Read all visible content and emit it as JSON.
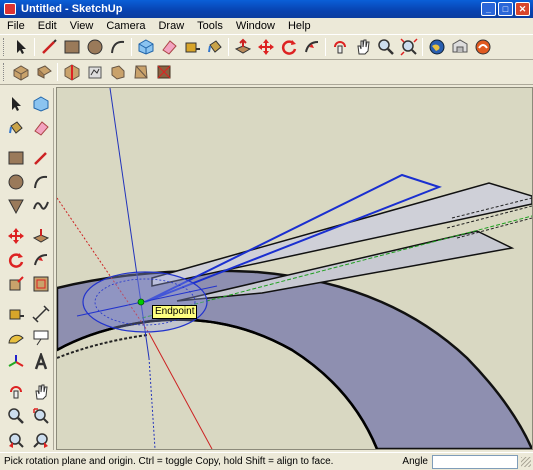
{
  "window": {
    "title": "Untitled - SketchUp"
  },
  "menu": [
    "File",
    "Edit",
    "View",
    "Camera",
    "Draw",
    "Tools",
    "Window",
    "Help"
  ],
  "viewport": {
    "tooltip": "Endpoint"
  },
  "status": {
    "message": "Pick rotation plane and origin.  Ctrl = toggle Copy, hold Shift = align to face.",
    "vcb_label": "Angle",
    "vcb_value": ""
  },
  "colors": {
    "titlebar": "#0842b0",
    "chrome": "#ece9d8",
    "viewport_bg": "#d9d8c2",
    "face": "#8e8fb0",
    "tooltip": "#ffff80"
  },
  "toolbar_main": [
    "select-icon",
    "line-icon",
    "rectangle-icon",
    "circle-icon",
    "arc-icon",
    "make-component-icon",
    "eraser-icon",
    "tape-measure-icon",
    "paint-bucket-icon",
    "push-pull-icon",
    "move-icon",
    "rotate-icon",
    "follow-me-icon",
    "orbit-icon",
    "pan-icon",
    "zoom-icon",
    "zoom-extents-icon",
    "earth-icon",
    "warehouse-icon",
    "share-icon"
  ],
  "toolbar_views": [
    "iso-view-icon",
    "top-view-icon",
    "front-view-icon",
    "right-view-icon",
    "back-view-icon",
    "left-view-icon",
    "bottom-view-icon"
  ],
  "toolbar_left": [
    "select-icon",
    "make-component-icon",
    "paint-bucket-icon",
    "eraser-icon",
    "rectangle-icon",
    "line-icon",
    "circle-icon",
    "arc-icon",
    "polygon-icon",
    "freehand-icon",
    "move-icon",
    "push-pull-icon",
    "rotate-icon",
    "follow-me-icon",
    "scale-icon",
    "offset-icon",
    "tape-measure-icon",
    "dimension-icon",
    "protractor-icon",
    "text-icon",
    "axes-icon",
    "3d-text-icon",
    "orbit-icon",
    "pan-icon",
    "zoom-icon",
    "zoom-window-icon",
    "previous-view-icon",
    "next-view-icon"
  ]
}
